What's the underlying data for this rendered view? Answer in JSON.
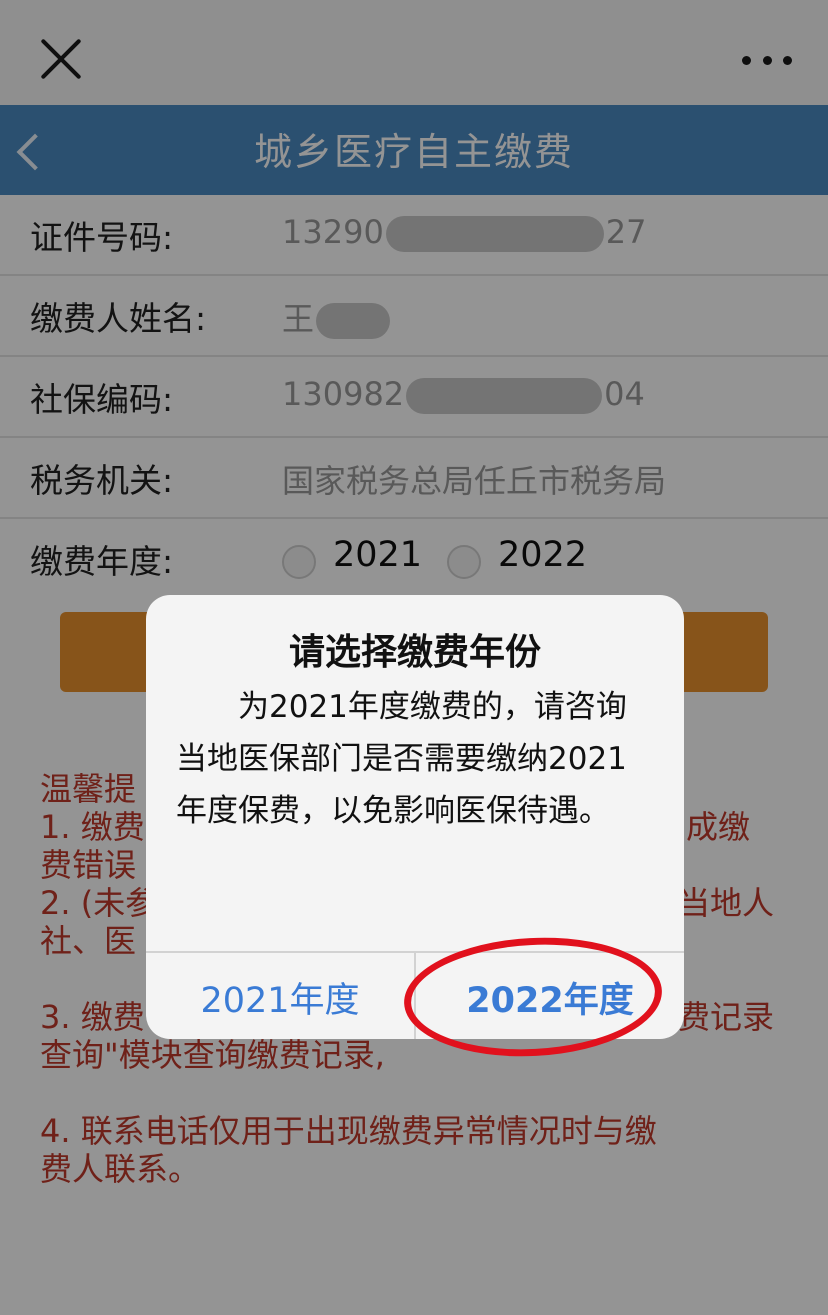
{
  "topbar": {
    "close_icon": "close-icon",
    "more_icon": "more-icon"
  },
  "navbar": {
    "title": "城乡医疗自主缴费"
  },
  "form": {
    "id_number": {
      "label": "证件号码:",
      "value_start": "13290",
      "value_end": "27"
    },
    "payer_name": {
      "label": "缴费人姓名:",
      "value_start": "王"
    },
    "social_code": {
      "label": "社保编码:",
      "value_start": "130982",
      "value_end": "04"
    },
    "tax_office": {
      "label": "税务机关:",
      "value": "国家税务总局任丘市税务局"
    },
    "year": {
      "label": "缴费年度:",
      "option_1": "2021",
      "option_2": "2022"
    }
  },
  "tips": {
    "line1": "温馨提",
    "line2a": "1. 缴费",
    "line2b": "成缴",
    "line3": "费错误",
    "line4a": "2. (未参",
    "line4b": "当地人",
    "line5": "社、医",
    "line6a": "3. 缴费",
    "line6b": "费记录",
    "line7": "查询\"模块查询缴费记录,",
    "line8": "4. 联系电话仅用于出现缴费异常情况时与缴",
    "line9": "费人联系。"
  },
  "dialog": {
    "title": "请选择缴费年份",
    "message": "为2021年度缴费的，请咨询当地医保部门是否需要缴纳2021年度保费，以免影响医保待遇。",
    "btn_2021": "2021年度",
    "btn_2022": "2022年度"
  },
  "colors": {
    "nav_blue": "#4a8ac2",
    "button_orange": "#e8922e",
    "tip_red": "#c0392b",
    "link_blue": "#3a7bd5",
    "ring_red": "#e1111d"
  }
}
